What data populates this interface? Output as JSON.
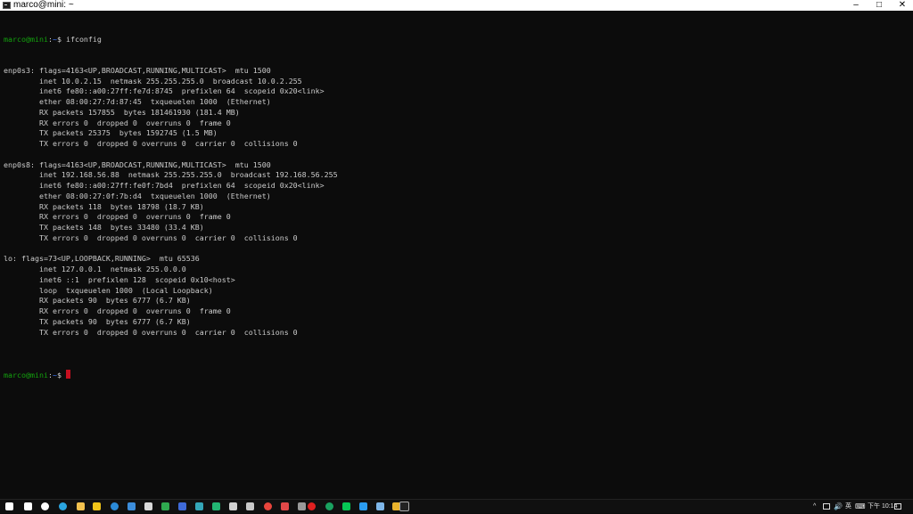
{
  "window": {
    "title": "marco@mini: ~",
    "minimize": "–",
    "maximize": "□",
    "close": "✕"
  },
  "terminal": {
    "prompt_user": "marco@mini",
    "prompt_sep": ":",
    "prompt_path": "~",
    "prompt_symbol": "$ ",
    "command": "ifconfig",
    "output": [
      "enp0s3: flags=4163<UP,BROADCAST,RUNNING,MULTICAST>  mtu 1500",
      "        inet 10.0.2.15  netmask 255.255.255.0  broadcast 10.0.2.255",
      "        inet6 fe80::a00:27ff:fe7d:8745  prefixlen 64  scopeid 0x20<link>",
      "        ether 08:00:27:7d:87:45  txqueuelen 1000  (Ethernet)",
      "        RX packets 157855  bytes 181461930 (181.4 MB)",
      "        RX errors 0  dropped 0  overruns 0  frame 0",
      "        TX packets 25375  bytes 1592745 (1.5 MB)",
      "        TX errors 0  dropped 0 overruns 0  carrier 0  collisions 0",
      "",
      "enp0s8: flags=4163<UP,BROADCAST,RUNNING,MULTICAST>  mtu 1500",
      "        inet 192.168.56.88  netmask 255.255.255.0  broadcast 192.168.56.255",
      "        inet6 fe80::a00:27ff:fe0f:7bd4  prefixlen 64  scopeid 0x20<link>",
      "        ether 08:00:27:0f:7b:d4  txqueuelen 1000  (Ethernet)",
      "        RX packets 118  bytes 18798 (18.7 KB)",
      "        RX errors 0  dropped 0  overruns 0  frame 0",
      "        TX packets 148  bytes 33480 (33.4 KB)",
      "        TX errors 0  dropped 0 overruns 0  carrier 0  collisions 0",
      "",
      "lo: flags=73<UP,LOOPBACK,RUNNING>  mtu 65536",
      "        inet 127.0.0.1  netmask 255.0.0.0",
      "        inet6 ::1  prefixlen 128  scopeid 0x10<host>",
      "        loop  txqueuelen 1000  (Local Loopback)",
      "        RX packets 90  bytes 6777 (6.7 KB)",
      "        RX errors 0  dropped 0  overruns 0  frame 0",
      "        TX packets 90  bytes 6777 (6.7 KB)",
      "        TX errors 0  dropped 0 overruns 0  carrier 0  collisions 0",
      ""
    ]
  },
  "taskbar": {
    "icons": [
      {
        "name": "start-icon",
        "color": "#ffffff"
      },
      {
        "name": "search-icon",
        "color": "#ffffff"
      },
      {
        "name": "task-view-icon",
        "color": "#ffffff"
      },
      {
        "name": "edge-icon",
        "color": "#2aa5e0"
      },
      {
        "name": "file-explorer-icon",
        "color": "#f2c14e"
      },
      {
        "name": "sticky-app-icon",
        "color": "#f0c419"
      },
      {
        "name": "ie-icon",
        "color": "#2b8ad8"
      },
      {
        "name": "remote-desktop-icon",
        "color": "#3c8ddb"
      },
      {
        "name": "notepad-icon",
        "color": "#d9d9d9"
      },
      {
        "name": "green-app-icon",
        "color": "#2fa84f"
      },
      {
        "name": "blue-app-icon",
        "color": "#3f6ad8"
      },
      {
        "name": "teal-app-icon",
        "color": "#34a6b8"
      },
      {
        "name": "chat-app-icon",
        "color": "#22b573"
      },
      {
        "name": "store-icon",
        "color": "#d0d0d0"
      },
      {
        "name": "cloud-app-icon",
        "color": "#c8c8c8"
      },
      {
        "name": "chrome-icon",
        "color": "#e8453c"
      },
      {
        "name": "media-app-icon",
        "color": "#e04848"
      },
      {
        "name": "terminal-alt-icon",
        "color": "#9a9a9a"
      },
      {
        "name": "record-app-icon",
        "color": "#e02020"
      },
      {
        "name": "green-circle-icon",
        "color": "#1aa260"
      },
      {
        "name": "line-icon",
        "color": "#06c755"
      },
      {
        "name": "vscode-icon",
        "color": "#2b9cf0"
      },
      {
        "name": "virtualbox-icon",
        "color": "#7eb6e8"
      },
      {
        "name": "tools-icon",
        "color": "#e8b22c"
      },
      {
        "name": "terminal-icon",
        "color": "#222222"
      }
    ],
    "tray": {
      "chevron": "^",
      "ime_lang": "英",
      "time_label": "下午 10:14"
    }
  }
}
